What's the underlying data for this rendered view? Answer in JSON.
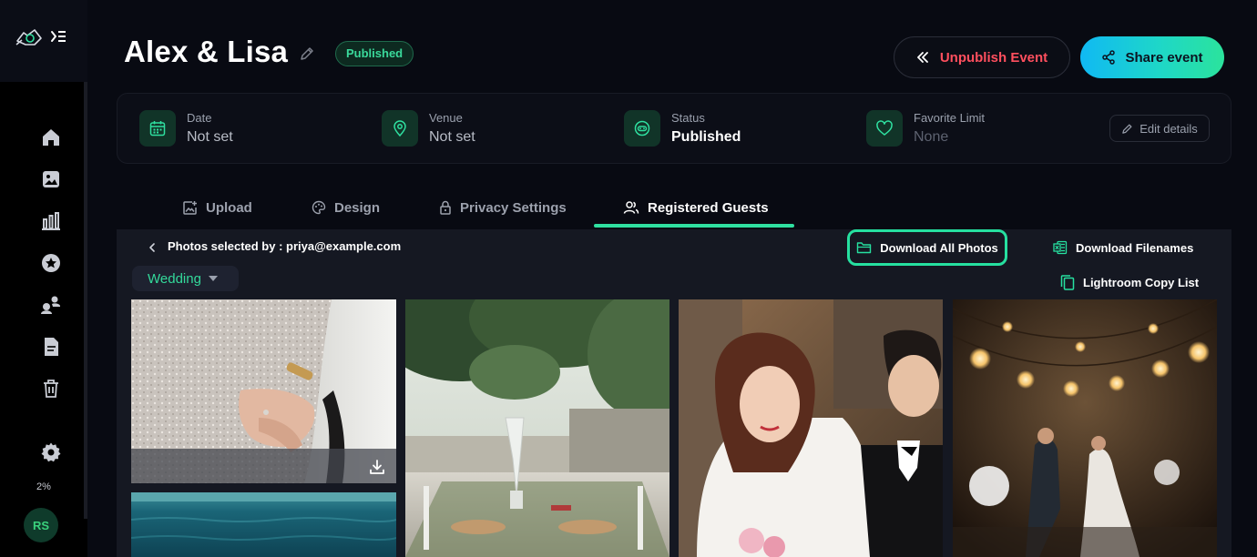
{
  "sidebar": {
    "logo_icon": "camera-logo-icon",
    "collapse_icon": "collapse-menu-icon",
    "nav": [
      {
        "name": "home",
        "icon": "home-icon"
      },
      {
        "name": "gallery",
        "icon": "image-icon"
      },
      {
        "name": "analytics",
        "icon": "bar-chart-icon"
      },
      {
        "name": "favorites",
        "icon": "star-icon"
      },
      {
        "name": "clients",
        "icon": "users-icon"
      },
      {
        "name": "documents",
        "icon": "document-icon"
      },
      {
        "name": "trash",
        "icon": "trash-icon"
      },
      {
        "name": "settings",
        "icon": "gear-icon"
      }
    ],
    "storage_label": "2%",
    "avatar_initials": "RS"
  },
  "header": {
    "title": "Alex & Lisa",
    "status_badge": "Published",
    "unpublish_label": "Unpublish Event",
    "share_label": "Share event"
  },
  "details": {
    "date": {
      "label": "Date",
      "value": "Not set"
    },
    "venue": {
      "label": "Venue",
      "value": "Not set"
    },
    "status": {
      "label": "Status",
      "value": "Published"
    },
    "favorite_limit": {
      "label": "Favorite Limit",
      "value": "None"
    },
    "edit_label": "Edit details"
  },
  "tabs": [
    {
      "label": "Upload",
      "icon": "upload-icon"
    },
    {
      "label": "Design",
      "icon": "palette-icon"
    },
    {
      "label": "Privacy Settings",
      "icon": "lock-icon"
    },
    {
      "label": "Registered Guests",
      "icon": "guests-icon",
      "active": true
    }
  ],
  "panel": {
    "selected_by": "Photos selected by : priya@example.com",
    "download_all_label": "Download All Photos",
    "download_filenames_label": "Download Filenames",
    "lightroom_label": "Lightroom Copy List",
    "album_selected": "Wedding"
  },
  "photos": [
    {
      "name": "photo-hands-lace-dress"
    },
    {
      "name": "photo-outdoor-table-setting"
    },
    {
      "name": "photo-bride-and-groom"
    },
    {
      "name": "photo-string-lights-dance"
    },
    {
      "name": "photo-sea"
    }
  ],
  "colors": {
    "accent": "#2fe0a0",
    "danger": "#ff4f5e",
    "share_gradient_start": "#10b9f3",
    "share_gradient_end": "#2be39c"
  }
}
